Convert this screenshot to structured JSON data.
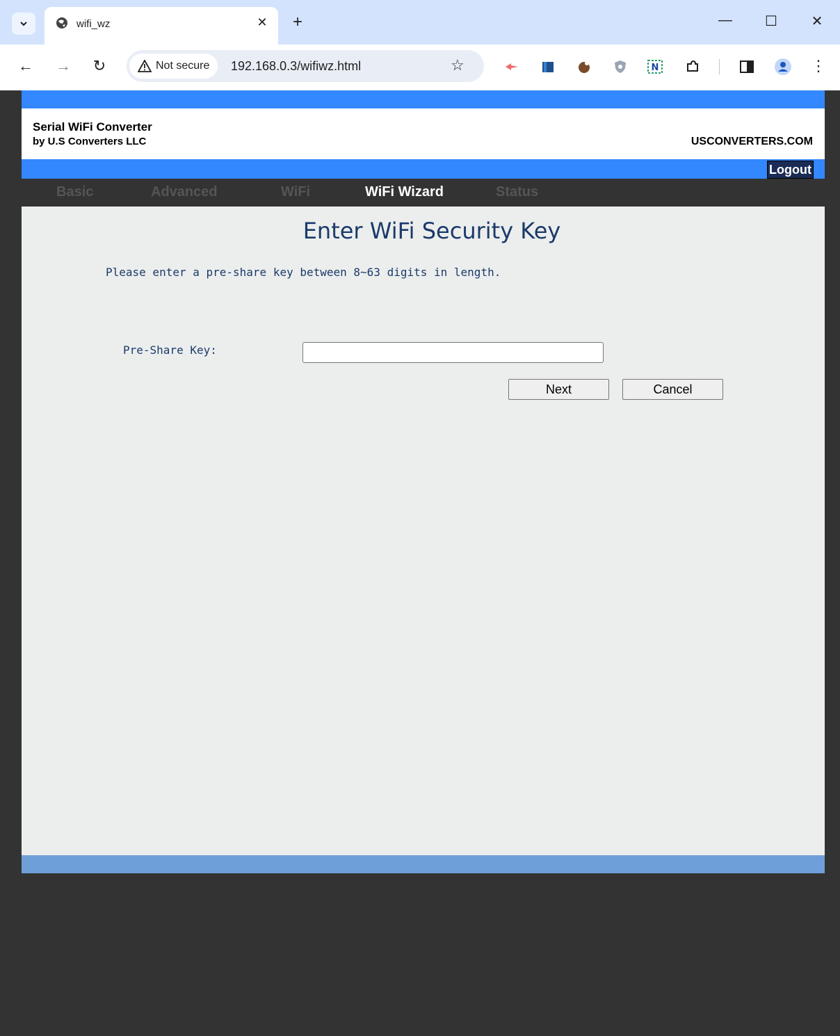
{
  "browser": {
    "tab_title": "wifi_wz",
    "security_label": "Not secure",
    "url": "192.168.0.3/wifiwz.html"
  },
  "header": {
    "title": "Serial WiFi Converter",
    "subtitle": "by U.S Converters LLC",
    "site": "USCONVERTERS.COM",
    "logout": "Logout"
  },
  "nav": {
    "items": [
      "Basic",
      "Advanced",
      "WiFi",
      "WiFi Wizard",
      "Status"
    ],
    "active": "WiFi Wizard"
  },
  "form": {
    "heading": "Enter WiFi Security Key",
    "hint": "Please enter a pre-share key between 8~63 digits in length.",
    "key_label": "Pre-Share Key:",
    "key_value": "",
    "next_label": "Next",
    "cancel_label": "Cancel"
  },
  "colors": {
    "bar_blue": "#3388ff",
    "footer_blue": "#6f9fd8",
    "text_navy": "#1a3a6a",
    "background_dark": "#333333",
    "content_bg": "#eceeed"
  }
}
